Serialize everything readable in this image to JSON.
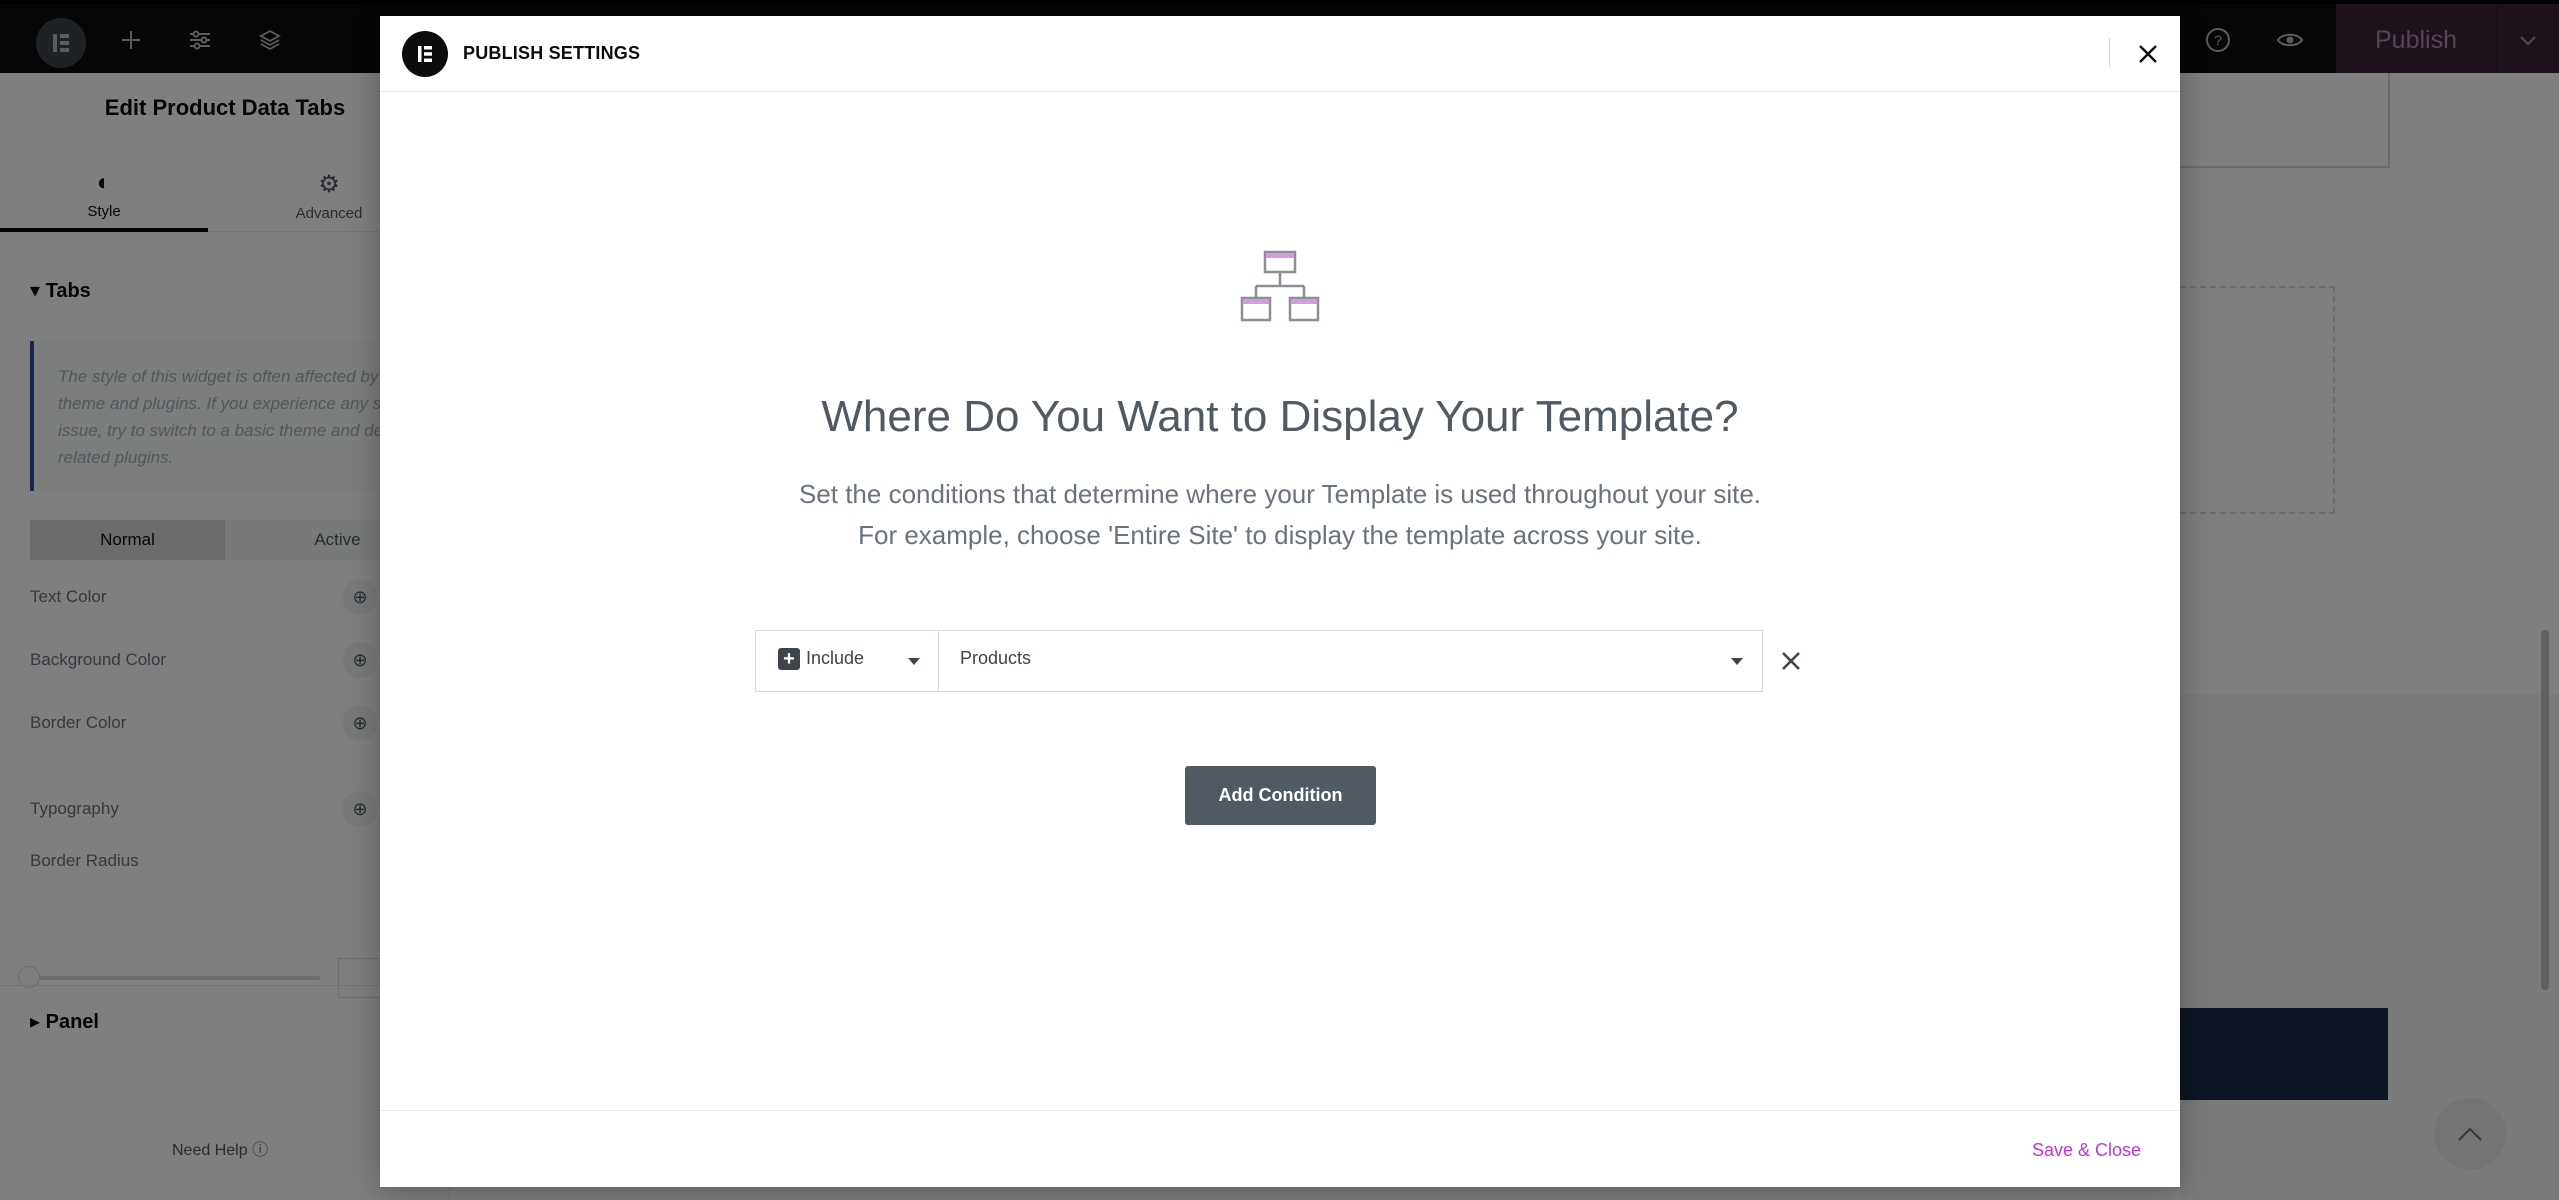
{
  "editor": {
    "publish_label": "Publish",
    "panel": {
      "title": "Edit Product Data Tabs",
      "tabs": [
        {
          "label": "Style",
          "icon": "half-circle-icon"
        },
        {
          "label": "Advanced",
          "icon": "gear-icon"
        }
      ],
      "section_tabs": "Tabs",
      "notice": "The style of this widget is often affected by your theme and plugins. If you experience any such issue, try to switch to a basic theme and deactivate related plugins.",
      "state_tabs": [
        "Normal",
        "Active"
      ],
      "controls": [
        "Text Color",
        "Background Color",
        "Border Color",
        "Typography",
        "Border Radius"
      ],
      "section_panel": "Panel",
      "need_help": "Need Help"
    }
  },
  "modal": {
    "title": "PUBLISH SETTINGS",
    "heading": "Where Do You Want to Display Your Template?",
    "description_line1": "Set the conditions that determine where your Template is used throughout your site.",
    "description_line2": "For example, choose 'Entire Site' to display the template across your site.",
    "condition": {
      "type": "Include",
      "value": "Products"
    },
    "add_condition": "Add Condition",
    "save_close": "Save & Close"
  },
  "colors": {
    "accent": "#c036d1",
    "dark": "#0c0d0e",
    "button": "#515962"
  }
}
